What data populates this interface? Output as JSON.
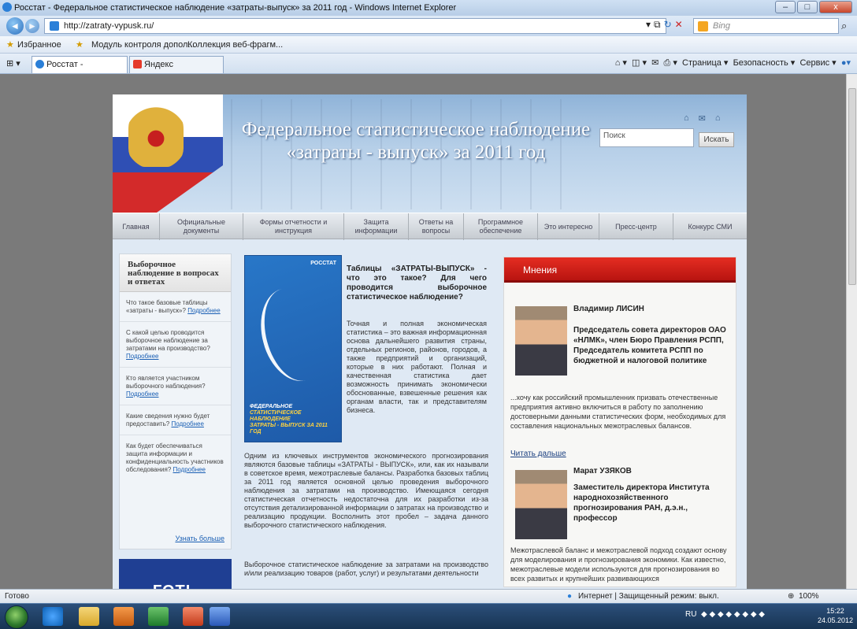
{
  "window": {
    "title": "Росстат - Федеральное статистическое наблюдение «затраты-выпуск» за 2011 год - Windows Internet Explorer",
    "min_label": "–",
    "max_label": "□",
    "close_label": "x"
  },
  "address": {
    "back_label": "◄",
    "forward_label": "►",
    "url": "http://zatraty-vypusk.ru/",
    "search_engine": "Bing",
    "search_icon": "⌕"
  },
  "favorites": {
    "label": "Избранное",
    "items": [
      "Модуль контроля допол...",
      "Коллекция веб-фрагм..."
    ]
  },
  "tabs": [
    {
      "label": "Росстат - Федерально..."
    },
    {
      "label": "Яндекс"
    }
  ],
  "commandbar": {
    "page": "Страница ▾",
    "safety": "Безопасность ▾",
    "tools": "Сервис ▾"
  },
  "site": {
    "title": "Федеральное статистическое наблюдение «затраты - выпуск» за 2011 год",
    "search_placeholder": "Поиск",
    "search_button": "Искать",
    "header_icons": [
      "home-icon",
      "mail-icon",
      "sitemap-icon"
    ],
    "nav": [
      "Главная",
      "Официальные документы",
      "Формы отчетности и инструкция",
      "Защита информации",
      "Ответы на вопросы",
      "Программное обеспечение",
      "Это интересно",
      "Пресс-центр",
      "Конкурс СМИ"
    ]
  },
  "sidebar": {
    "title": "Выборочное наблюдение в вопросах и ответах",
    "more_label": "Подробнее",
    "items": [
      "Что такое базовые таблицы «затраты - выпуск»?",
      "С какой целью проводится выборочное наблюдение за затратами на производство?",
      "Кто является участником выборочного наблюдения?",
      "Какие сведения нужно будет предоставить?",
      "Как будет обеспечиваться защита информации и конфиденциальность участников обследования?"
    ],
    "footer_link": "Узнать больше",
    "banner_text": "ГОТЬ"
  },
  "poster": {
    "brand": "РОССТАТ",
    "line1": "ФЕДЕРАЛЬНОЕ",
    "line2": "СТАТИСТИЧЕСКОЕ НАБЛЮДЕНИЕ",
    "line3": "ЗАТРАТЫ - ВЫПУСК ЗА 2011 ГОД"
  },
  "article": {
    "question": "Таблицы «ЗАТРАТЫ-ВЫПУСК» - что это такое? Для чего проводится выборочное статистическое наблюдение?",
    "para1": "Точная и полная экономическая статистика – это важная информационная основа дальнейшего развития страны, отдельных регионов, районов, городов, а также предприятий и организаций, которые в них работают. Полная и качественная статистика дает возможность принимать экономически обоснованные, взвешенные решения как органам власти, так и представителям бизнеса.",
    "para2": "Одним из ключевых инструментов экономического прогнозирования являются базовые таблицы «ЗАТРАТЫ - ВЫПУСК», или, как их называли в советское время, межотраслевые балансы. Разработка базовых таблиц за 2011 год является основной целью проведения выборочного наблюдения за затратами на производство. Имеющаяся сегодня статистическая отчетность недостаточна для их разработки из-за отсутствия детализированной информации о затратах на производство и реализацию продукции. Восполнить этот пробел – задача данного выборочного статистического наблюдения.",
    "para3": "Выборочное статистическое наблюдение за затратами на производство и/или реализацию товаров (работ, услуг) и результатами деятельности"
  },
  "opinions": {
    "title": "Мнения",
    "read_more": "Читать дальше",
    "people": [
      {
        "name": "Владимир ЛИСИН",
        "role": "Председатель совета директоров ОАО «НЛМК», член Бюро Правления РСПП, Председатель комитета РСПП по бюджетной и налоговой политике",
        "quote": "...хочу как российский промышленник призвать отечественные предприятия активно включиться в работу по заполнению достоверными данными статистических форм, необходимых для составления национальных межотраслевых балансов."
      },
      {
        "name": "Марат УЗЯКОВ",
        "role": "Заместитель директора Института народнохозяйственного прогнозирования РАН, д.э.н., профессор",
        "quote": "Межотраслевой баланс и межотраслевой подход создают основу для моделирования и прогнозирования экономики. Как известно, межотраслевые модели используются для прогнозирования во всех развитых и крупнейших развивающихся"
      }
    ]
  },
  "status": {
    "left": "Готово",
    "zone": "Интернет | Защищенный режим: выкл.",
    "zoom": "100%"
  },
  "taskbar": {
    "lang": "RU",
    "time": "15:22",
    "date": "24.05.2012",
    "apps": [
      "ie-icon",
      "explorer-icon",
      "outlook-icon",
      "excel-icon",
      "powerpoint-icon",
      "word-icon"
    ]
  },
  "colors": {
    "accent_red": "#d21b14",
    "header_blue": "#8fb3d8",
    "link": "#1a5fb4"
  }
}
